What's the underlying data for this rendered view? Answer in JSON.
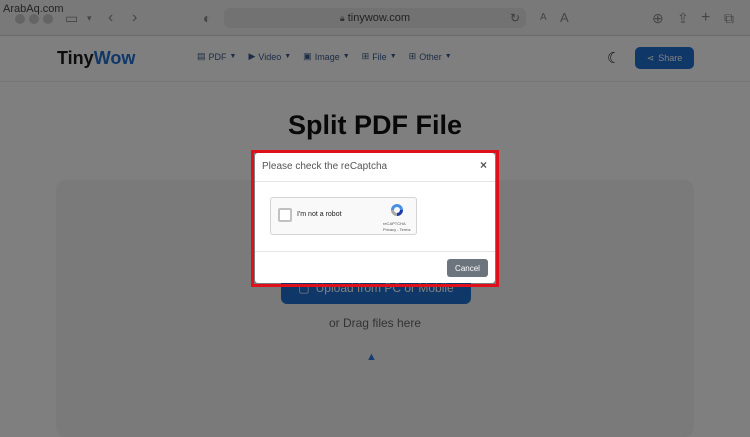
{
  "watermark": "ArabAq.com",
  "browser": {
    "url": "tinywow.com",
    "text_size_small": "A",
    "text_size_large": "A"
  },
  "header": {
    "logo_part1": "Tiny",
    "logo_part2": "Wow",
    "nav": [
      {
        "label": "PDF"
      },
      {
        "label": "Video"
      },
      {
        "label": "Image"
      },
      {
        "label": "File"
      },
      {
        "label": "Other"
      }
    ],
    "share_label": "Share"
  },
  "page": {
    "title": "Split PDF File",
    "upload_label": "Upload from PC or Mobile",
    "drag_text": "or Drag files here"
  },
  "modal": {
    "title": "Please check the reCaptcha",
    "close": "×",
    "captcha_label": "I'm not a robot",
    "captcha_brand": "reCAPTCHA",
    "captcha_links": "Privacy - Terms",
    "cancel_label": "Cancel"
  },
  "colors": {
    "accent": "#1f6fd1",
    "highlight": "#e0101a",
    "cancel": "#6c757d"
  }
}
